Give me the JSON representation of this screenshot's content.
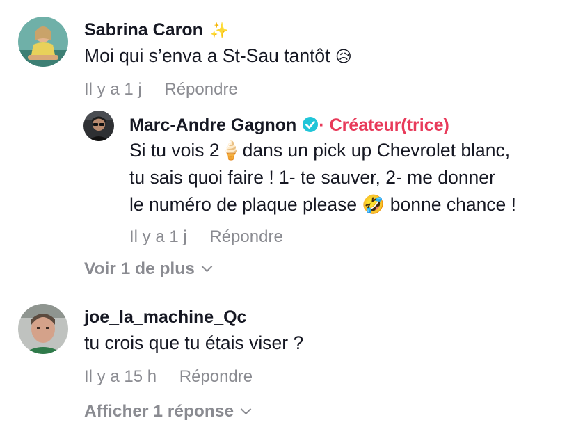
{
  "comments": [
    {
      "username": "Sabrina  Caron",
      "badge_icon": "sparkles-icon",
      "text": "Moi qui s’enva a St-Sau tantôt",
      "emoji": "😥",
      "time": "Il y a 1 j",
      "reply_label": "Répondre",
      "reply": {
        "username": "Marc-Andre Gagnon",
        "verified_icon": "verified-badge-icon",
        "creator_label": "· Créateur(trice)",
        "lines": [
          "Si tu vois 2🍦dans un pick up Chevrolet blanc,",
          "tu sais quoi faire ! 1- te sauver, 2- me donner",
          "le numéro de plaque please 🤣 bonne chance !"
        ],
        "time": "Il y a 1 j",
        "reply_label": "Répondre"
      },
      "more_label": "Voir 1 de plus"
    },
    {
      "username": "joe_la_machine_Qc",
      "text": "tu crois que tu étais viser ?",
      "time": "Il y a 15 h",
      "reply_label": "Répondre",
      "more_label": "Afficher 1 réponse"
    }
  ],
  "colors": {
    "text": "#161823",
    "meta": "#8a8b91",
    "creator": "#e83a5a",
    "verified": "#20c5d8"
  }
}
